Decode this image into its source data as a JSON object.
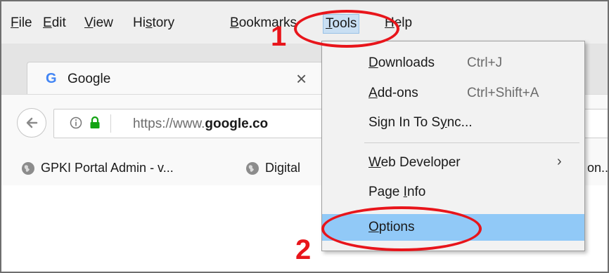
{
  "menu_bar": {
    "items": [
      {
        "label": "File",
        "mnemonic": "F",
        "rest": "ile"
      },
      {
        "label": "Edit",
        "mnemonic": "E",
        "rest": "dit"
      },
      {
        "label": "View",
        "mnemonic": "V",
        "rest": "iew"
      },
      {
        "label": "History",
        "pre": "Hi",
        "mnemonic": "s",
        "rest": "tory"
      },
      {
        "label": "Bookmarks",
        "mnemonic": "B",
        "rest": "ookmarks"
      },
      {
        "label": "Tools",
        "mnemonic": "T",
        "rest": "ools"
      },
      {
        "label": "Help",
        "mnemonic": "H",
        "rest": "elp"
      }
    ]
  },
  "tab": {
    "favicon": "G",
    "title": "Google",
    "close": "×"
  },
  "address_bar": {
    "url_prefix": "https://www.",
    "url_domain": "google.co"
  },
  "bookmarks": [
    {
      "icon": "globe-icon",
      "label": "GPKI Portal Admin - v..."
    },
    {
      "icon": "globe-icon",
      "label": "Digital"
    },
    {
      "label": "on..."
    }
  ],
  "tools_menu": {
    "items": [
      {
        "pre": "",
        "mnemonic": "D",
        "rest": "ownloads",
        "shortcut": "Ctrl+J"
      },
      {
        "pre": "",
        "mnemonic": "A",
        "rest": "dd-ons",
        "shortcut": "Ctrl+Shift+A"
      },
      {
        "pre": "Sign In To S",
        "mnemonic": "y",
        "rest": "nc...",
        "shortcut": ""
      },
      {
        "pre": "",
        "mnemonic": "W",
        "rest": "eb Developer",
        "shortcut": "",
        "submenu": "›"
      },
      {
        "pre": "Page ",
        "mnemonic": "I",
        "rest": "nfo",
        "shortcut": ""
      },
      {
        "pre": "",
        "mnemonic": "O",
        "rest": "ptions",
        "shortcut": "",
        "highlighted": true
      }
    ]
  },
  "annotations": {
    "step1": "1",
    "step2": "2"
  },
  "colors": {
    "annotation": "#e8151b",
    "highlight": "#91c9f7",
    "active_menu": "#c9dff3"
  }
}
